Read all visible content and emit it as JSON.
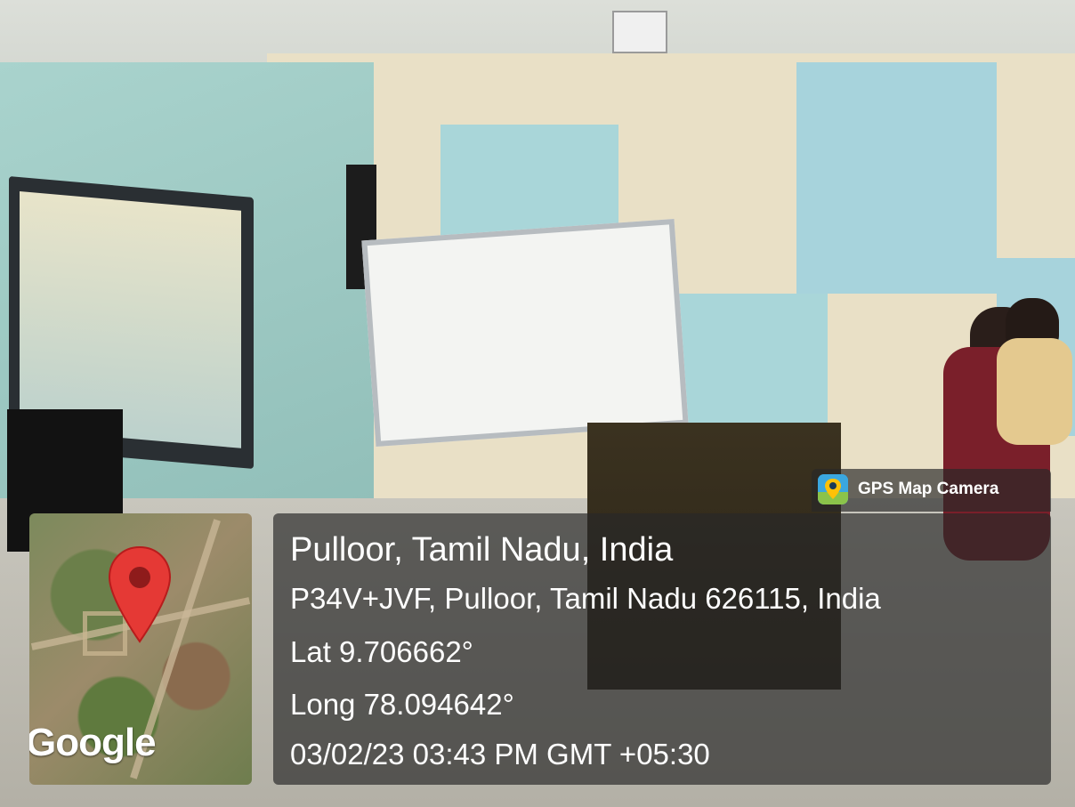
{
  "overlay": {
    "brand": {
      "label": "GPS Map Camera",
      "icon": "map-pin-camera-icon"
    },
    "map": {
      "provider_label": "Google",
      "marker_icon": "location-pin-icon",
      "marker_color": "#e53935"
    },
    "location": {
      "place": "Pulloor, Tamil Nadu, India",
      "address": "P34V+JVF, Pulloor, Tamil Nadu 626115, India",
      "latitude": "Lat 9.706662°",
      "longitude": "Long 78.094642°",
      "datetime": "03/02/23 03:43 PM GMT +05:30"
    },
    "panel_color": "#282828"
  }
}
